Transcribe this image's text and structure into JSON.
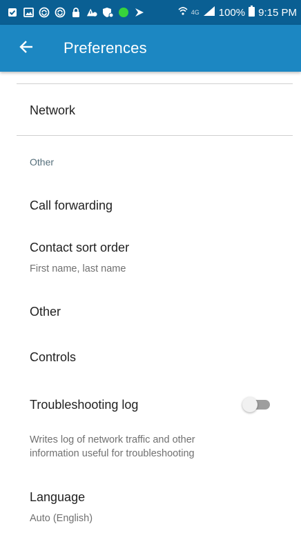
{
  "status_bar": {
    "left_icons": [
      "checkbox-icon",
      "image-icon",
      "sync-icon",
      "sync-icon",
      "lock-icon",
      "alert-icon",
      "shield-icon",
      "green-dot-icon",
      "play-icon"
    ],
    "network_label": "4G",
    "battery": "100%",
    "time": "9:15 PM",
    "colors": {
      "background": "#0a5f93",
      "dot": "#37d43c"
    }
  },
  "app_bar": {
    "title": "Preferences",
    "back_icon": "arrow-left-icon",
    "background": "#1c87c2"
  },
  "items": {
    "network": {
      "title": "Network"
    },
    "other_header": "Other",
    "call_forwarding": {
      "title": "Call forwarding"
    },
    "contact_sort_order": {
      "title": "Contact sort order",
      "summary": "First name, last name"
    },
    "other": {
      "title": "Other"
    },
    "controls": {
      "title": "Controls"
    },
    "troubleshooting_log": {
      "title": "Troubleshooting log",
      "summary_line1": "Writes log of network traffic and other",
      "summary_line2": "information useful for troubleshooting",
      "enabled": false
    },
    "language": {
      "title": "Language",
      "summary": "Auto (English)"
    }
  }
}
